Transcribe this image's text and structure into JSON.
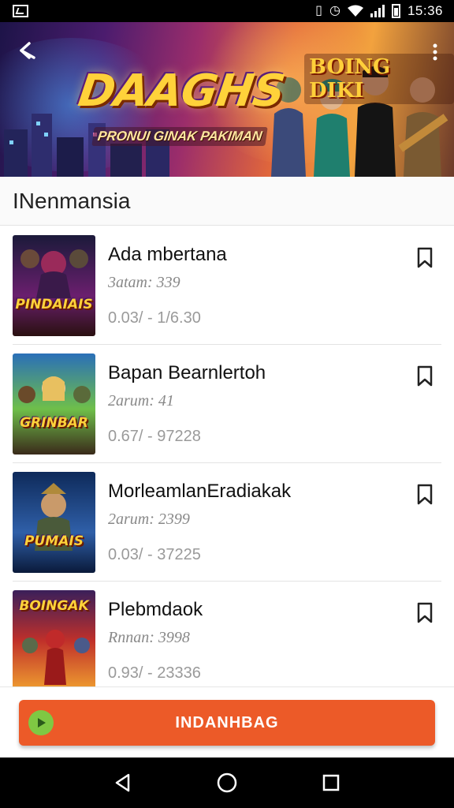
{
  "status_bar": {
    "time": "15:36",
    "icons": [
      "gallery-icon",
      "vibrate-icon",
      "alarm-icon",
      "wifi-icon",
      "signal-icon",
      "battery-icon"
    ]
  },
  "banner": {
    "title": "DAAGHS",
    "subtitle": "PRONUI GINAK PAKIMAN",
    "logo": "BOING DIKI"
  },
  "section": {
    "title": "INenmansia"
  },
  "items": [
    {
      "title": "Ada mbertana",
      "line1": "3atam: 339",
      "line2": "0.03/ - 1/6.30",
      "art": "PINDAIAIS",
      "palette": [
        "#1b1a3a",
        "#6a1f6e",
        "#d2a21e"
      ]
    },
    {
      "title": "Bapan Bearnlertoh",
      "line1": "2arum: 41",
      "line2": "0.67/ - 97228",
      "art": "GRINBAR",
      "palette": [
        "#2a6fb8",
        "#6fbf4a",
        "#d84a2a"
      ]
    },
    {
      "title": "MorleamlanEradiakak",
      "line1": "2arum: 2399",
      "line2": "0.03/ - 37225",
      "art": "PUMAIS",
      "palette": [
        "#0e2a5a",
        "#2f5fa8",
        "#d9a93a"
      ]
    },
    {
      "title": "Plebmdaok",
      "line1": "Rnnan: 3998",
      "line2": "0.93/ - 23336",
      "art": "BOINGAK",
      "palette": [
        "#3a1f5a",
        "#c0302a",
        "#f0a030"
      ]
    }
  ],
  "action": {
    "label": "INDANHBAG"
  },
  "colors": {
    "accent": "#ec5a28",
    "icon_green": "#7fc843"
  }
}
